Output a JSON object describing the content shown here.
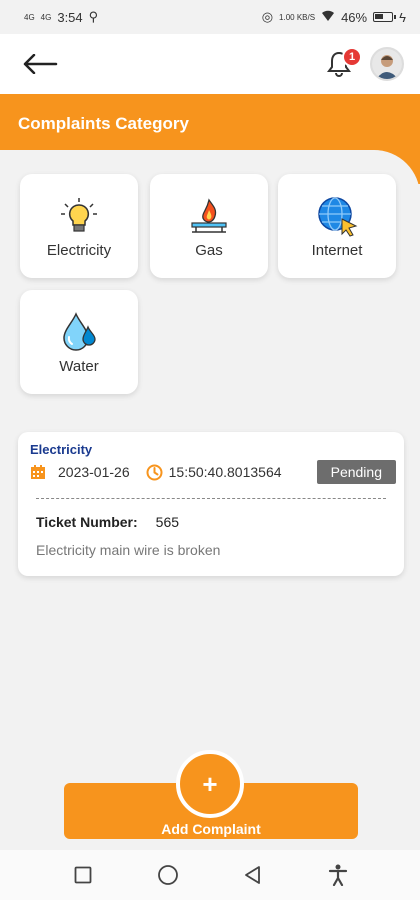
{
  "status_bar": {
    "signal1": "4G",
    "signal2": "4G",
    "time": "3:54",
    "network_speed": "1.00 KB/S",
    "battery": "46%"
  },
  "header": {
    "back_icon": "arrow-left-icon",
    "notification_count": "1",
    "bell_icon": "bell-icon"
  },
  "section": {
    "title": "Complaints Category"
  },
  "categories": [
    {
      "label": "Electricity",
      "icon": "lightbulb-icon"
    },
    {
      "label": "Gas",
      "icon": "gas-flame-icon"
    },
    {
      "label": "Internet",
      "icon": "globe-cursor-icon"
    },
    {
      "label": "Water",
      "icon": "water-drop-icon"
    }
  ],
  "complaint": {
    "category": "Electricity",
    "date": "2023-01-26",
    "time": "15:50:40.8013564",
    "status": "Pending",
    "ticket_label": "Ticket Number:",
    "ticket_number": "565",
    "description": "Electricity main wire is broken"
  },
  "add_button": {
    "plus": "+",
    "label": "Add Complaint"
  },
  "colors": {
    "accent": "#f7941d",
    "category_text": "#1a3a8f",
    "status_badge": "#6d6d6d",
    "notification_badge": "#e53935"
  }
}
